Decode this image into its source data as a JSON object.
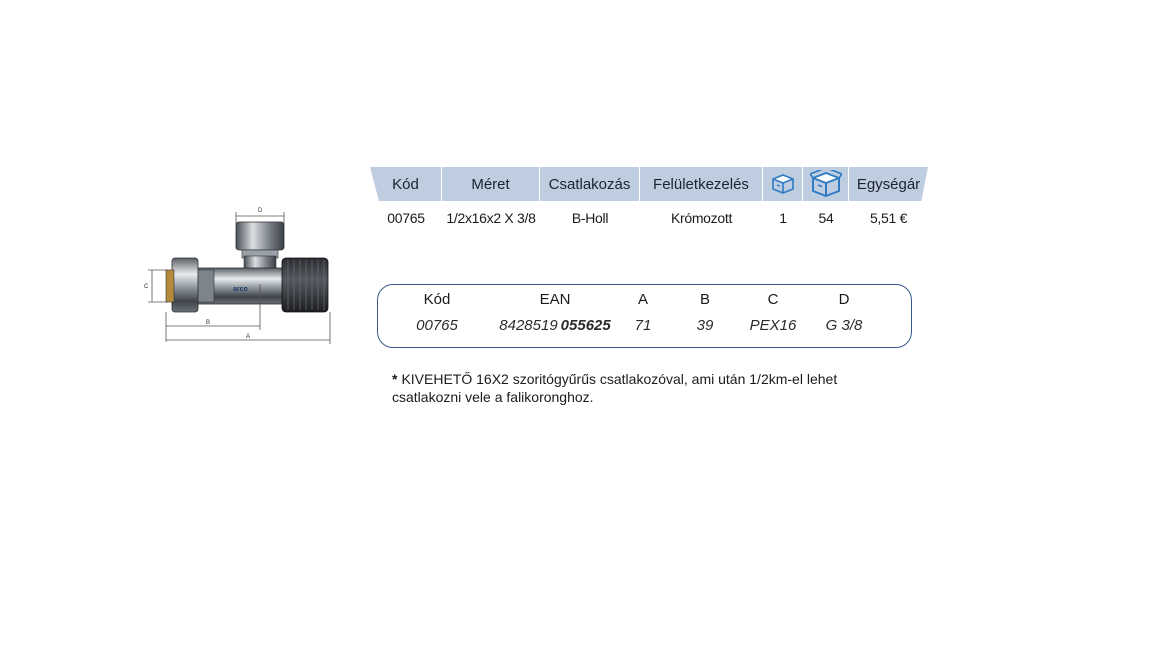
{
  "price_table": {
    "headers": [
      "Kód",
      "Méret",
      "Csatlakozás",
      "Felületkezelés",
      "box-icon",
      "box-large-icon",
      "Egységár"
    ],
    "row": {
      "kod": "00765",
      "meret": "1/2x16x2 X 3/8",
      "csatlakozas": "B-Holl",
      "feluletkezeles": "Krómozott",
      "small_pack": "1",
      "large_pack": "54",
      "egysegar": "5,51 €"
    }
  },
  "spec_table": {
    "headers": [
      "Kód",
      "EAN",
      "A",
      "B",
      "C",
      "D"
    ],
    "row": {
      "kod": "00765",
      "ean_prefix": "8428519",
      "ean_suffix": "055625",
      "a": "71",
      "b": "39",
      "c": "PEX16",
      "d": "G 3/8"
    }
  },
  "footnote": {
    "star": "*",
    "text": "KIVEHETŐ 16X2 szoritógyűrűs csatlakozóval, ami után 1/2km-el lehet csatlakozni vele a falikoronghoz."
  },
  "drawing": {
    "dimension_labels": [
      "D",
      "C",
      "B",
      "A"
    ],
    "brand": "arco"
  },
  "colors": {
    "header_bg": "#bfcde0",
    "border_blue": "#355a8a",
    "icon_blue": "#2f7bc4"
  }
}
